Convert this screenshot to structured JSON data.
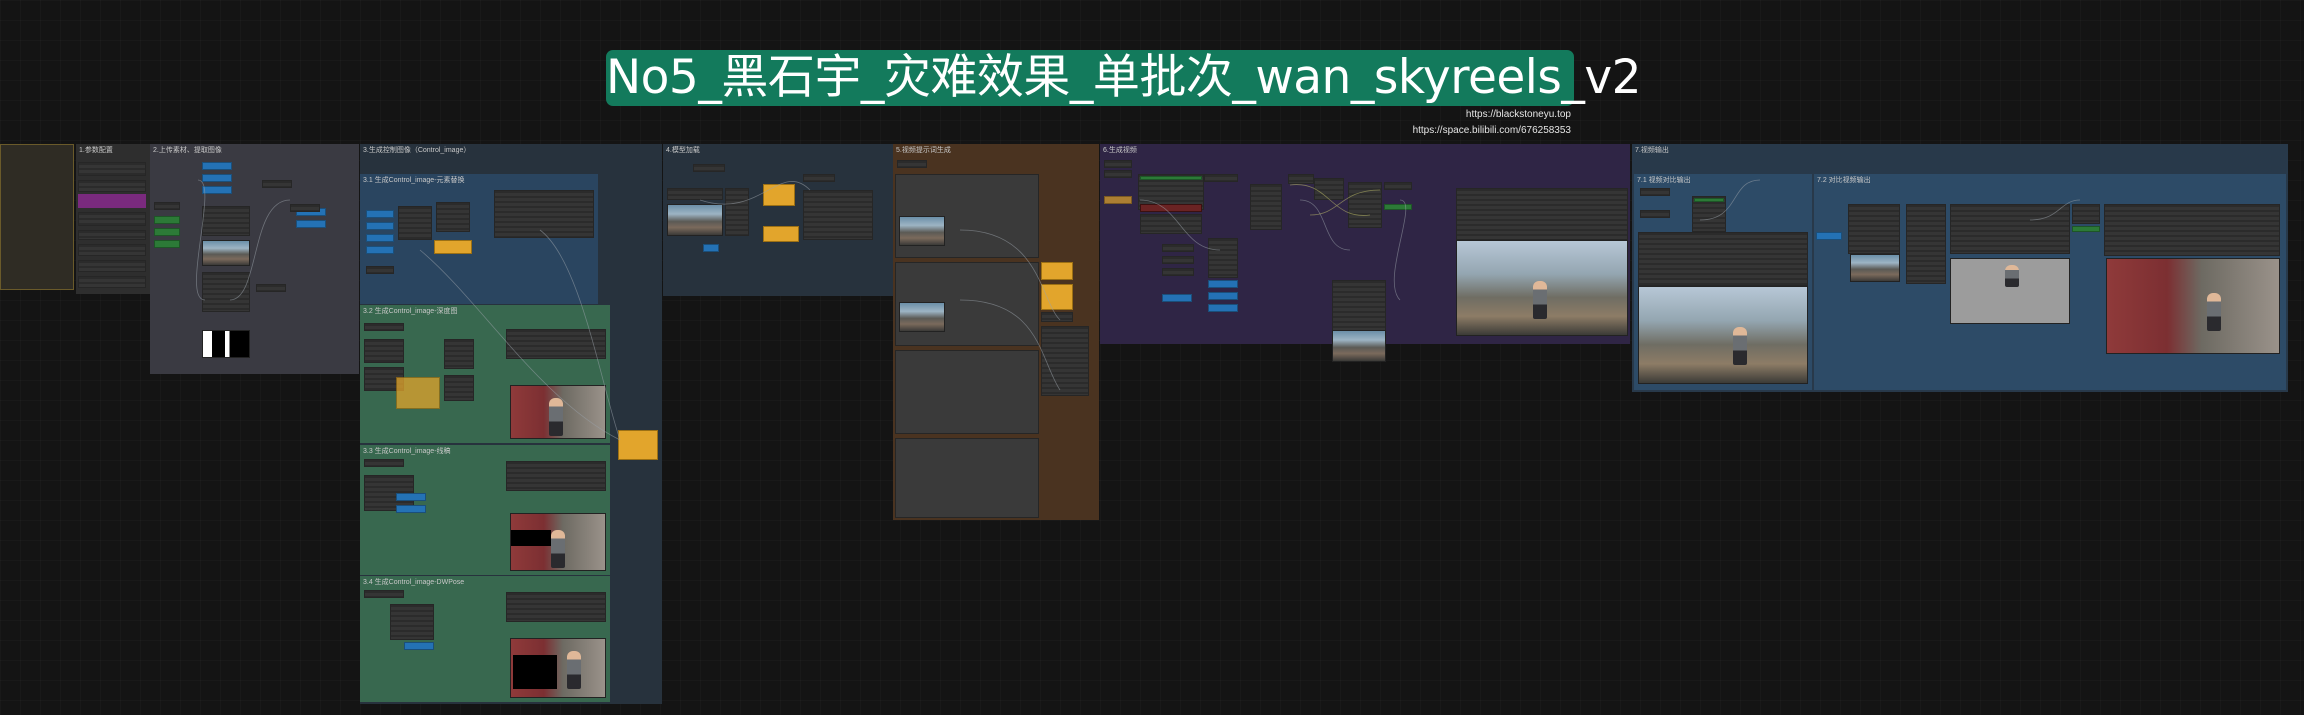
{
  "canvas": {
    "background": "#141414"
  },
  "title": {
    "text": "No5_黑石宇_灾难效果_单批次_wan_skyreels_v2",
    "color": "#137a5c"
  },
  "links": [
    "https://blackstoneyu.top",
    "https://space.bilibili.com/676258353"
  ],
  "groups": [
    {
      "id": "g1",
      "label": "1.参数配置",
      "color": "#3a3a3a"
    },
    {
      "id": "g2",
      "label": "2.上传素材、提取图像",
      "color": "#3b3b45"
    },
    {
      "id": "g3",
      "label": "3.生成控制图像（Control_image）",
      "color": "#2b3b4b"
    },
    {
      "id": "g31",
      "label": "3.1 生成Control_image-元素替换",
      "color": "#2d4b67"
    },
    {
      "id": "g32",
      "label": "3.2 生成Control_image-深度图",
      "color": "#3a6e52"
    },
    {
      "id": "g33",
      "label": "3.3 生成Control_image-线稿",
      "color": "#3a6e52"
    },
    {
      "id": "g34",
      "label": "3.4 生成Control_image-DWPose",
      "color": "#3a6e52"
    },
    {
      "id": "g4",
      "label": "4.模型加载",
      "color": "#2b3b4b"
    },
    {
      "id": "g5",
      "label": "5.视频提示词生成",
      "color": "#4a3320"
    },
    {
      "id": "g6",
      "label": "6.生成视频",
      "color": "#2f2545"
    },
    {
      "id": "g7",
      "label": "7.视频输出",
      "color": "#28394a"
    },
    {
      "id": "g71",
      "label": "7.1 视频对比输出",
      "color": "#2d4b67"
    },
    {
      "id": "g72",
      "label": "7.2 对比视频输出",
      "color": "#2d4b67"
    }
  ],
  "icons": [
    "person-figure",
    "link-wire"
  ]
}
